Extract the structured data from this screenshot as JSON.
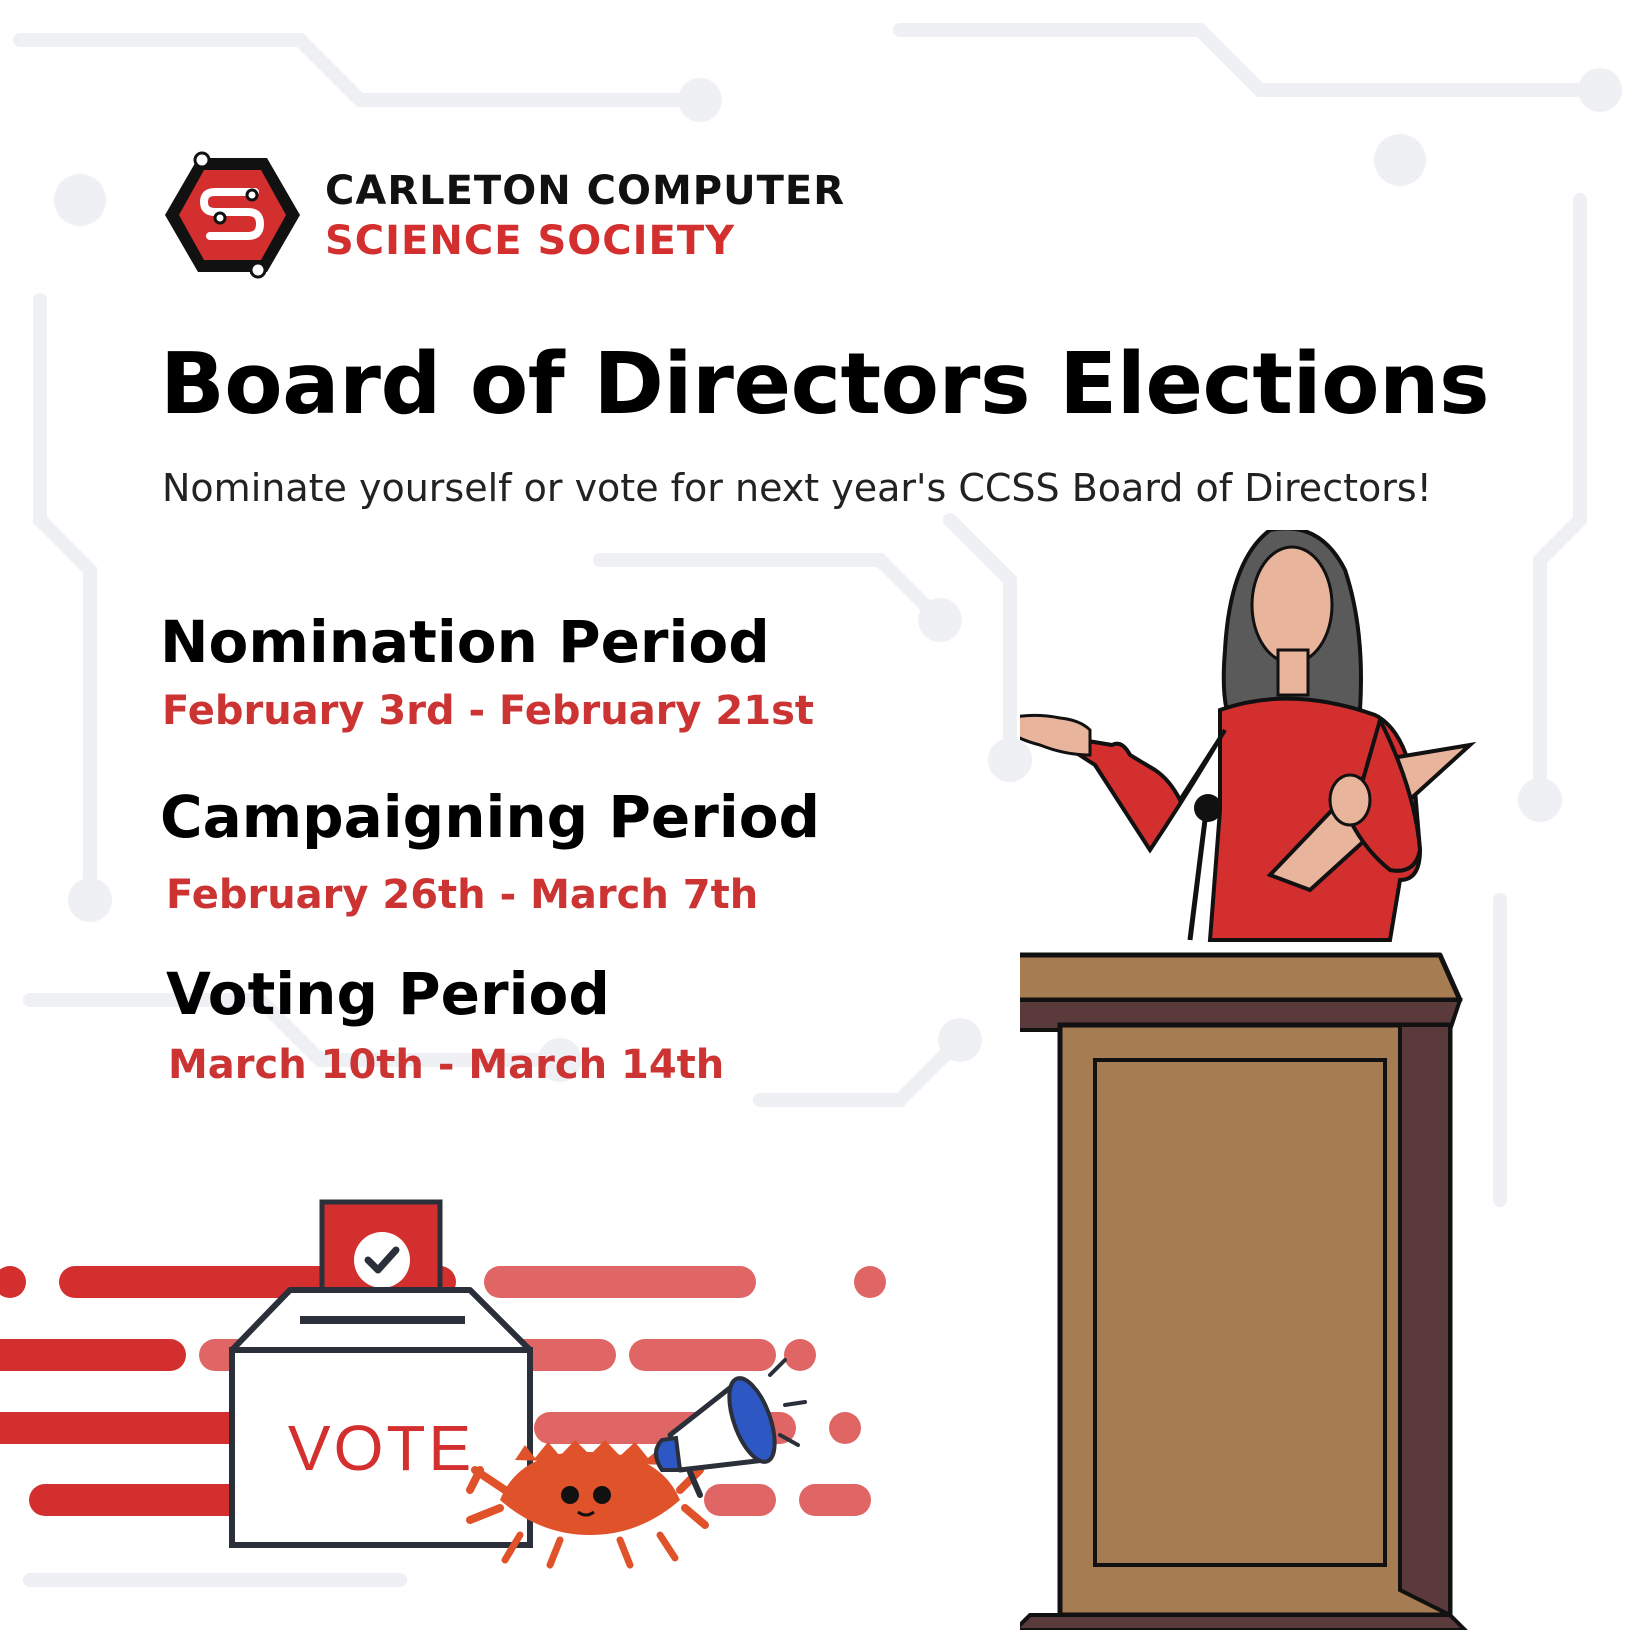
{
  "org": {
    "name_line1": "CARLETON COMPUTER",
    "name_line2": "SCIENCE SOCIETY",
    "logo": "ccss-hexagon-logo-icon"
  },
  "headline": "Board of Directors Elections",
  "subtitle": "Nominate yourself or vote for next year's CCSS Board of Directors!",
  "periods": [
    {
      "title": "Nomination Period",
      "dates": "February 3rd - February 21st"
    },
    {
      "title": "Campaigning Period",
      "dates": "February 26th - March 7th"
    },
    {
      "title": "Voting Period",
      "dates": "March 10th - March 14th"
    }
  ],
  "illustration": {
    "ballot_box_label": "VOTE",
    "icons": [
      "ballot-box-icon",
      "checkmark-icon",
      "crab-mascot-icon",
      "megaphone-icon",
      "speaker-at-podium-icon"
    ]
  },
  "colors": {
    "accent_red": "#d32f2f",
    "date_red": "#cc3333",
    "light_red": "#e06666",
    "text_black": "#000000",
    "podium_brown": "#a67c52",
    "podium_dark": "#5a3a3a"
  }
}
